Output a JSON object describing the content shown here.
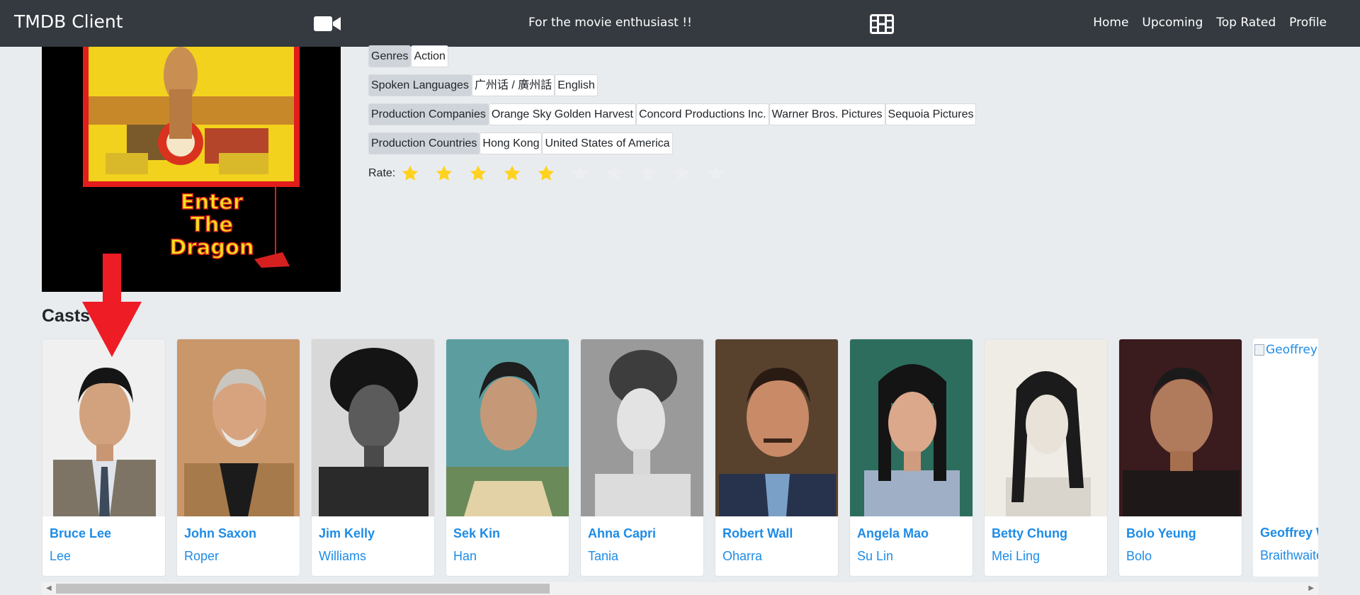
{
  "navbar": {
    "brand": "TMDB Client",
    "tagline": "For the movie enthusiast !!",
    "camera_icon": "video-camera-icon",
    "film_icon": "film-icon",
    "links": [
      "Home",
      "Upcoming",
      "Top Rated",
      "Profile"
    ]
  },
  "poster": {
    "title_lines": [
      "Enter",
      "The",
      "Dragon"
    ]
  },
  "details": {
    "genres": {
      "label": "Genres",
      "values": [
        "Action"
      ]
    },
    "spoken_languages": {
      "label": "Spoken Languages",
      "values": [
        "广州话 / 廣州話",
        "English"
      ]
    },
    "production_companies": {
      "label": "Production Companies",
      "values": [
        "Orange Sky Golden Harvest",
        "Concord Productions Inc.",
        "Warner Bros. Pictures",
        "Sequoia Pictures"
      ]
    },
    "production_countries": {
      "label": "Production Countries",
      "values": [
        "Hong Kong",
        "United States of America"
      ]
    },
    "rate": {
      "label": "Rate:",
      "value": 5,
      "max": 10
    }
  },
  "casts": {
    "title": "Casts",
    "items": [
      {
        "name": "Bruce Lee",
        "character": "Lee"
      },
      {
        "name": "John Saxon",
        "character": "Roper"
      },
      {
        "name": "Jim Kelly",
        "character": "Williams"
      },
      {
        "name": "Sek Kin",
        "character": "Han"
      },
      {
        "name": "Ahna Capri",
        "character": "Tania"
      },
      {
        "name": "Robert Wall",
        "character": "Oharra"
      },
      {
        "name": "Angela Mao",
        "character": "Su Lin"
      },
      {
        "name": "Betty Chung",
        "character": "Mei Ling"
      },
      {
        "name": "Bolo Yeung",
        "character": "Bolo"
      },
      {
        "name": "Geoffrey Weeks",
        "character": "Braithwaite",
        "alt": "Geoffrey Weeks"
      }
    ]
  },
  "colors": {
    "navbar": "#343a40",
    "link_blue": "#1e8ce6",
    "star_on": "#ffd21f",
    "star_off": "#eceef0",
    "annotation_arrow": "#ee1c25"
  }
}
